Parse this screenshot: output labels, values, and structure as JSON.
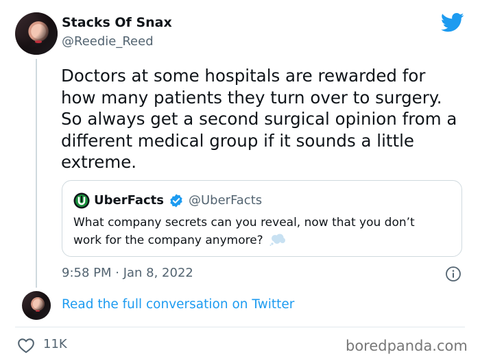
{
  "tweet": {
    "author_name": "Stacks Of Snax",
    "author_handle": "@Reedie_Reed",
    "text": "Doctors at some hospitals are rewarded for how many patients they turn over to surgery. So always get a second surgical opinion from a different medical group if it sounds a little extreme.",
    "timestamp": "9:58 PM · Jan 8, 2022",
    "likes": "11K"
  },
  "quote": {
    "author_name": "UberFacts",
    "author_handle": "@UberFacts",
    "text": "What company secrets can you reveal, now that you don’t work for the company anymore?",
    "logo_letter": "U"
  },
  "footer": {
    "read_more": "Read the full conversation on Twitter",
    "watermark": "boredpanda.com"
  },
  "colors": {
    "accent": "#1d9bf0",
    "secondary_text": "#536471",
    "uberfacts_green": "#1a8f3c"
  },
  "icons": [
    "twitter-bird-icon",
    "verified-badge-icon",
    "thought-bubble-emoji",
    "info-icon",
    "heart-icon"
  ]
}
